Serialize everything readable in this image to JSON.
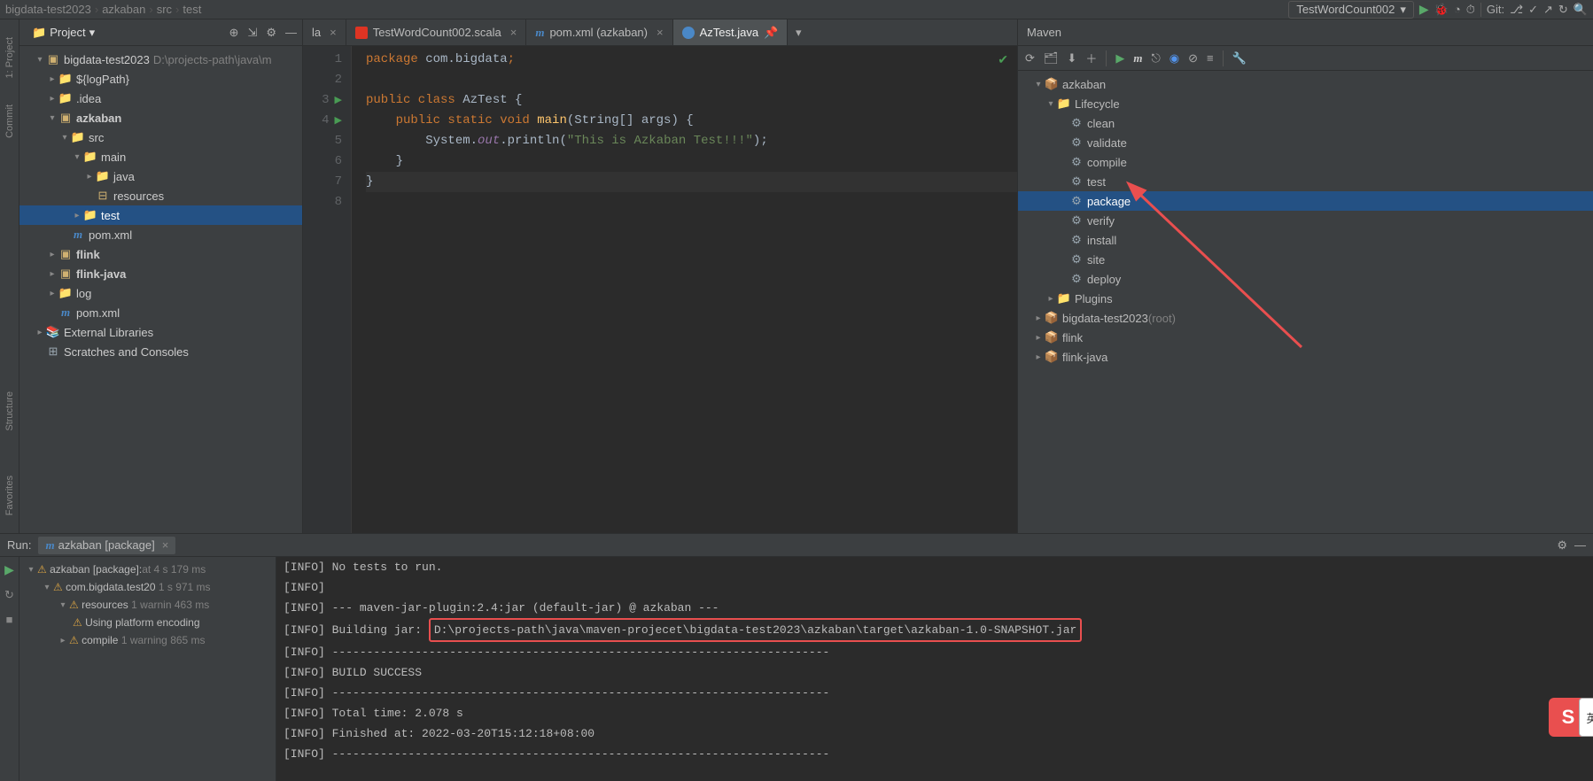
{
  "breadcrumbs": [
    "bigdata-test2023",
    "azkaban",
    "src",
    "test"
  ],
  "runConfig": "TestWordCount002",
  "vcsLabel": "Git:",
  "projectPanel": {
    "title": "Project"
  },
  "tree": {
    "root": {
      "name": "bigdata-test2023",
      "path": "D:\\projects-path\\java\\m"
    },
    "logPath": "${logPath}",
    "idea": ".idea",
    "azkaban": "azkaban",
    "src": "src",
    "main": "main",
    "java": "java",
    "resources": "resources",
    "test": "test",
    "pom1": "pom.xml",
    "flink": "flink",
    "flinkJava": "flink-java",
    "log": "log",
    "pom2": "pom.xml",
    "extLib": "External Libraries",
    "scratches": "Scratches and Consoles"
  },
  "tabs": {
    "t0": "la",
    "t1": "TestWordCount002.scala",
    "t2": "pom.xml (azkaban)",
    "t3": "AzTest.java"
  },
  "code": {
    "l1a": "package",
    "l1b": " com.bigdata",
    "l1c": ";",
    "l3a": "public class ",
    "l3b": "AzTest ",
    "l3c": "{",
    "l4a": "    public static void ",
    "l4b": "main",
    "l4c": "(String[] args) {",
    "l5a": "        System.",
    "l5b": "out",
    "l5c": ".println(",
    "l5d": "\"This is Azkaban Test!!!\"",
    "l5e": ");",
    "l6": "    }",
    "l7": "}",
    "lines": [
      "1",
      "2",
      "3",
      "4",
      "5",
      "6",
      "7",
      "8"
    ]
  },
  "maven": {
    "title": "Maven",
    "root": "azkaban",
    "lifecycle": "Lifecycle",
    "goals": [
      "clean",
      "validate",
      "compile",
      "test",
      "package",
      "verify",
      "install",
      "site",
      "deploy"
    ],
    "plugins": "Plugins",
    "proj1": "bigdata-test2023",
    "proj1suffix": " (root)",
    "proj2": "flink",
    "proj3": "flink-java",
    "mIcon": "m"
  },
  "run": {
    "label": "Run:",
    "tab": "azkaban [package]",
    "treeRoot": "azkaban [package]:",
    "treeRootTime": " at 4 s 179 ms",
    "child1": "com.bigdata.test20",
    "child1Time": "1 s 971 ms",
    "child2": "resources",
    "child2Det": "1 warnin",
    "child2Time": "463 ms",
    "child3": "Using platform encoding",
    "child4": "compile",
    "child4Det": "1 warning",
    "child4Time": "865 ms",
    "console": [
      "[INFO] No tests to run.",
      "[INFO]",
      "[INFO] --- maven-jar-plugin:2.4:jar (default-jar) @ azkaban ---",
      {
        "prefix": "[INFO] Building jar: ",
        "hl": "D:\\projects-path\\java\\maven-projecet\\bigdata-test2023\\azkaban\\target\\azkaban-1.0-SNAPSHOT.jar"
      },
      "[INFO] ------------------------------------------------------------------------",
      "[INFO] BUILD SUCCESS",
      "[INFO] ------------------------------------------------------------------------",
      "[INFO] Total time:  2.078 s",
      "[INFO] Finished at: 2022-03-20T15:12:18+08:00",
      "[INFO] ------------------------------------------------------------------------"
    ]
  },
  "ime": "S",
  "ime2": "英"
}
